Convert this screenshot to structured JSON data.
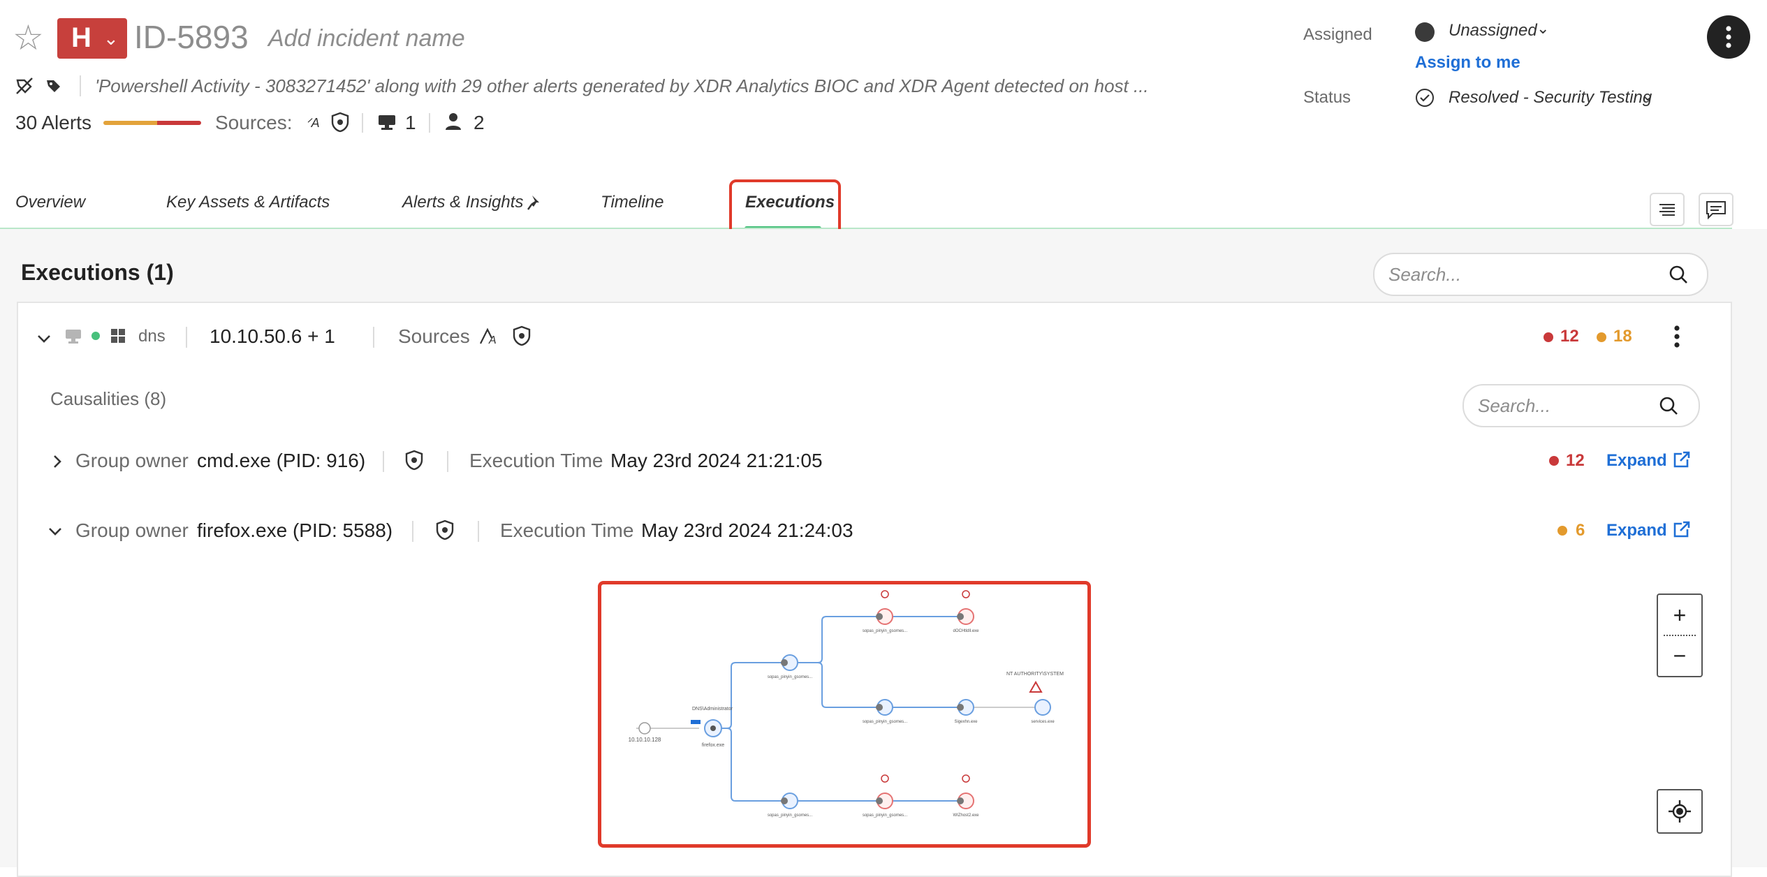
{
  "header": {
    "severity": "H",
    "incident_id": "ID-5893",
    "incident_name_placeholder": "Add incident name",
    "description": "'Powershell Activity - 3083271452' along with 29 other alerts generated by XDR Analytics BIOC and XDR Agent detected on host ...",
    "alerts_count": "30 Alerts",
    "sources_label": "Sources:",
    "hosts_count": "1",
    "users_count": "2"
  },
  "meta": {
    "assigned_label": "Assigned",
    "assignee": "Unassigned",
    "assign_to_me": "Assign to me",
    "status_label": "Status",
    "status_value": "Resolved - Security Testing"
  },
  "tabs": [
    {
      "label": "Overview"
    },
    {
      "label": "Key Assets & Artifacts"
    },
    {
      "label": "Alerts & Insights"
    },
    {
      "label": "Timeline"
    },
    {
      "label": "Executions"
    }
  ],
  "executions": {
    "title": "Executions (1)",
    "search_placeholder": "Search...",
    "host": {
      "name": "dns",
      "ip": "10.10.50.6 + 1",
      "sources_label": "Sources",
      "high_count": "12",
      "medium_count": "18"
    },
    "causalities": {
      "title": "Causalities (8)",
      "search_placeholder": "Search...",
      "groups": [
        {
          "owner_label": "Group owner",
          "owner": "cmd.exe (PID: 916)",
          "exec_label": "Execution Time",
          "exec_time": "May 23rd 2024 21:21:05",
          "count": "12",
          "expand": "Expand"
        },
        {
          "owner_label": "Group owner",
          "owner": "firefox.exe (PID: 5588)",
          "exec_label": "Execution Time",
          "exec_time": "May 23rd 2024 21:24:03",
          "count": "6",
          "expand": "Expand"
        }
      ]
    }
  },
  "diagram": {
    "source_ip": "10.10.10.128",
    "user": "DNS\\Administrator",
    "root_process": "firefox.exe",
    "nt_authority": "NT AUTHORITY\\SYSTEM",
    "nodes": [
      "sopas_pinyin_gsomes...",
      "sopas_pinyin_gsomes...",
      "dOCHtldll.exe",
      "sopas_pinyin_gsomes...",
      "Sigexhn.exe",
      "services.exe",
      "sopas_pinyin_gsomes...",
      "sopas_pinyin_gsomes...",
      "WIZhost2.exe"
    ]
  },
  "colors": {
    "severity_high": "#c7403c",
    "accent_blue": "#1f6fd6",
    "tab_active": "#48c07c",
    "highlight_red": "#e03a2a",
    "high": "#c9393a",
    "medium": "#e39a2d"
  }
}
